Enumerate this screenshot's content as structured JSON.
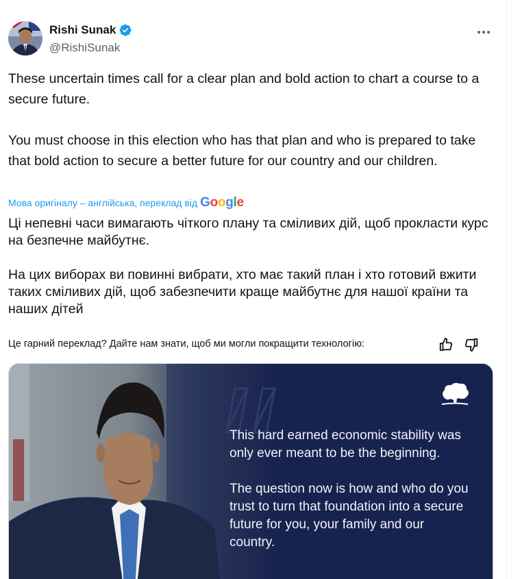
{
  "author": {
    "display_name": "Rishi Sunak",
    "handle": "@RishiSunak",
    "verified_icon": "verified-badge-icon",
    "avatar_icon": "profile-photo"
  },
  "tweet": {
    "text": "These uncertain times call for a clear plan and bold action to chart a course to a secure future.\n\nYou must choose in this election who has that plan and who is prepared to take that bold action to secure a better future for our country and our children.",
    "translation_note": "Мова оригіналу – англійська, переклад від",
    "translation_provider": "Google",
    "translated_text": "Ці непевні часи вимагають чіткого плану та сміливих дій, щоб прокласти курс на безпечне майбутнє.\n\nНа цих виборах ви повинні вибрати, хто має такий план і хто готовий вжити таких сміливих дій, щоб забезпечити краще майбутнє для нашої країни та наших дітей",
    "feedback_prompt": "Це гарний переклад? Дайте нам знати, щоб ми могли покращити технологію:"
  },
  "media": {
    "quote_text": "This hard earned economic stability was only ever meant to be the beginning.\n\nThe question now is how and who do you trust to turn that foundation into a secure future for you, your family and our country."
  },
  "colors": {
    "link_blue": "#1d9bf0",
    "verified_blue": "#1d9bf0",
    "secondary_text": "#536471",
    "media_navy": "#17234f"
  }
}
